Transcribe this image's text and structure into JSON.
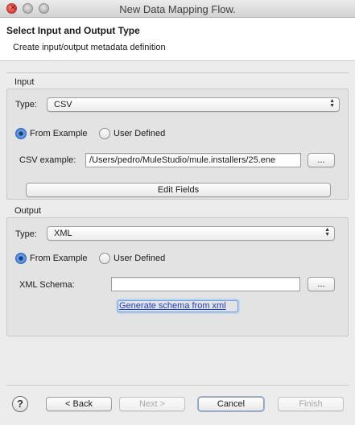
{
  "window": {
    "title": "New Data Mapping Flow."
  },
  "header": {
    "title": "Select Input and Output Type",
    "description": "Create input/output metadata definition"
  },
  "input": {
    "group_label": "Input",
    "type_label": "Type:",
    "type_value": "CSV",
    "radio_from_example": "From Example",
    "radio_user_defined": "User Defined",
    "selected": "From Example",
    "example_label": "CSV example:",
    "example_value": "/Users/pedro/MuleStudio/mule.installers/25.ene",
    "browse_label": "...",
    "edit_fields_label": "Edit Fields"
  },
  "output": {
    "group_label": "Output",
    "type_label": "Type:",
    "type_value": "XML",
    "radio_from_example": "From Example",
    "radio_user_defined": "User Defined",
    "selected": "From Example",
    "schema_label": "XML Schema:",
    "schema_value": "",
    "browse_label": "...",
    "generate_link": "Generate schema from xml"
  },
  "footer": {
    "help_label": "?",
    "back_label": "< Back",
    "next_label": "Next >",
    "cancel_label": "Cancel",
    "finish_label": "Finish"
  },
  "icons": {
    "close": "close-icon",
    "minimize": "minimize-icon",
    "maximize": "maximize-icon",
    "help": "help-icon",
    "select_arrows": "up-down-arrows-icon"
  },
  "colors": {
    "accent": "#3f7fd8",
    "link": "#1a3ec8"
  }
}
